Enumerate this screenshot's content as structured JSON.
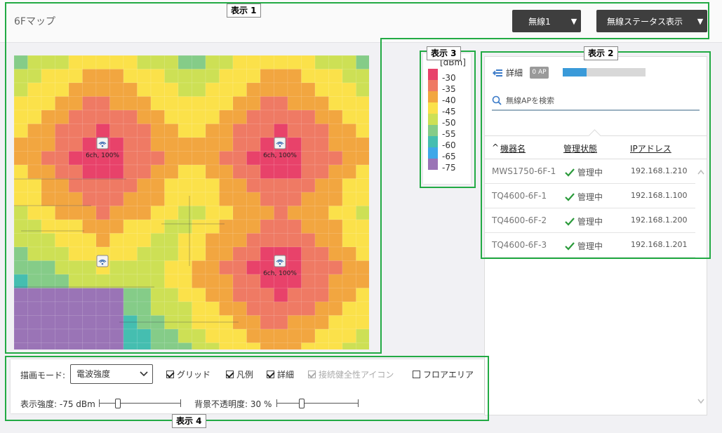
{
  "header": {
    "title": "6Fマップ",
    "wireless_select": "無線1",
    "status_button": "無線ステータス表示"
  },
  "map": {
    "ap_labels": [
      "6ch, 100%",
      "6ch, 100%",
      "6ch, 100%"
    ]
  },
  "legend": {
    "unit": "[dBm]",
    "items": [
      {
        "value": "-30",
        "color": "#e8426a"
      },
      {
        "value": "-35",
        "color": "#ef7a64"
      },
      {
        "value": "-40",
        "color": "#f2a640"
      },
      {
        "value": "-45",
        "color": "#fbe14a"
      },
      {
        "value": "-50",
        "color": "#cde055"
      },
      {
        "value": "-55",
        "color": "#85cc88"
      },
      {
        "value": "-60",
        "color": "#45beb0"
      },
      {
        "value": "-65",
        "color": "#3fa8e8"
      },
      {
        "value": "-75",
        "color": "#9a74b6"
      }
    ]
  },
  "panel": {
    "detail_label": "詳細",
    "ap_count": "0 AP",
    "progress_fraction": 0.29,
    "search_placeholder": "無線APを検索",
    "columns": {
      "name": "機器名",
      "status": "管理状態",
      "ip": "IPアドレス"
    },
    "rows": [
      {
        "name": "MWS1750-6F-1",
        "status": "管理中",
        "ip": "192.168.1.210"
      },
      {
        "name": "TQ4600-6F-1",
        "status": "管理中",
        "ip": "192.168.1.100"
      },
      {
        "name": "TQ4600-6F-2",
        "status": "管理中",
        "ip": "192.168.1.200"
      },
      {
        "name": "TQ4600-6F-3",
        "status": "管理中",
        "ip": "192.168.1.201"
      }
    ]
  },
  "controls": {
    "mode_label": "描画モード:",
    "mode_value": "電波強度",
    "checkboxes": {
      "grid": "グリッド",
      "legend": "凡例",
      "detail": "詳細",
      "health": "接続健全性アイコン",
      "floor": "フロアエリア"
    },
    "strength_label": "表示強度: -75 dBm",
    "opacity_label": "背景不透明度: 30 %"
  },
  "annotations": {
    "d1": "表示 1",
    "d2": "表示 2",
    "d3": "表示 3",
    "d4": "表示 4"
  },
  "colors": {
    "annotation": "#22aa44",
    "status_ok": "#2a9a3a"
  }
}
